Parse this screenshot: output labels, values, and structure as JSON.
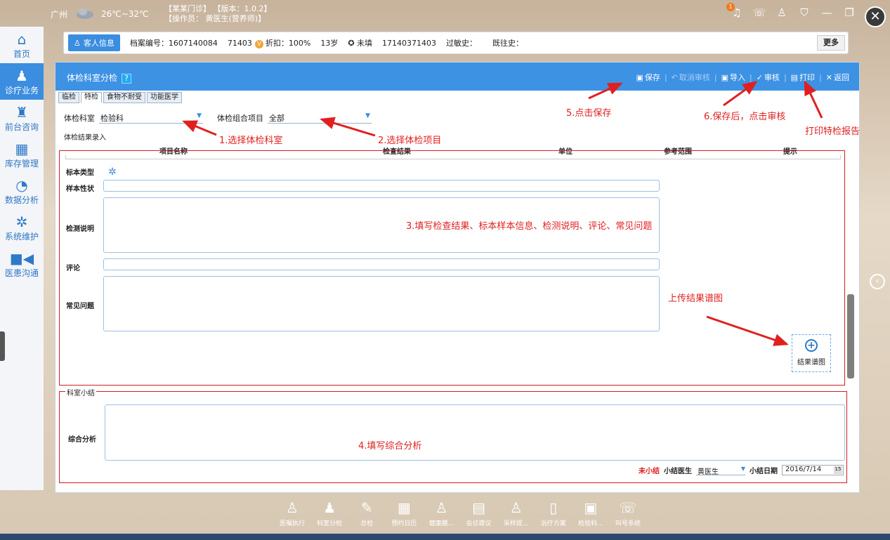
{
  "header": {
    "city": "广州",
    "temperature": "26℃~32℃",
    "clinic": "【某某门诊】",
    "version": "【版本：1.0.2】",
    "operator": "【操作员： 黄医生(营养师)】",
    "notification_count": "1"
  },
  "nav": [
    {
      "label": "首页",
      "icon": "home-icon"
    },
    {
      "label": "诊疗业务",
      "icon": "doctor-icon"
    },
    {
      "label": "前台咨询",
      "icon": "reception-icon"
    },
    {
      "label": "库存管理",
      "icon": "store-icon"
    },
    {
      "label": "数据分析",
      "icon": "chart-icon"
    },
    {
      "label": "系统维护",
      "icon": "gear-icon"
    },
    {
      "label": "医患沟通",
      "icon": "video-icon"
    }
  ],
  "patient": {
    "tab_label": "客人信息",
    "record_no": "档案编号：1607140084",
    "id": "71403",
    "discount": "折扣：100%",
    "age": "13岁",
    "marital": "未填",
    "phone": "17140371403",
    "allergy": "过敏史：",
    "history": "既往史：",
    "more": "更多"
  },
  "panel": {
    "title": "体检科室分检",
    "help": "?",
    "toolbar": {
      "save": "保存",
      "cancel_review": "取消审核",
      "import": "导入",
      "review": "审核",
      "print": "打印",
      "back": "返回"
    },
    "tabs": [
      "临检",
      "特检",
      "食物不耐受",
      "功能医学"
    ],
    "dept_label": "体检科室",
    "dept_value": "检验科",
    "combo_label": "体检组合项目",
    "combo_value": "全部",
    "entry_title": "体检结果录入",
    "columns": [
      "项目名称",
      "检查结果",
      "单位",
      "参考范围",
      "提示"
    ],
    "fields": {
      "sample_type": "标本类型",
      "sample_props": "样本性状",
      "test_desc": "检测说明",
      "comment": "评论",
      "faq": "常见问题"
    },
    "upload_label": "结果谱图",
    "summary_legend": "科室小结",
    "analysis_label": "综合分析",
    "unsummed": "未小结",
    "summary_doctor_label": "小结医生",
    "summary_doctor": "黄医生",
    "summary_date_label": "小结日期",
    "summary_date": "2016/7/14",
    "cal_icon": "15"
  },
  "annotations": {
    "a1": "1.选择体检科室",
    "a2": "2.选择体检项目",
    "a3": "3.填写检查结果、标本样本信息、检测说明、评论、常见问题",
    "a4": "4.填写综合分析",
    "a5": "5.点击保存",
    "a6": "6.保存后，点击审核",
    "a7": "打印特检报告",
    "a8": "上传结果谱图"
  },
  "dock": [
    "医嘱执行",
    "科室分检",
    "总检",
    "预约日历",
    "健康膳...",
    "会诊建议",
    "采样提...",
    "治疗方案",
    "检验科...",
    "叫号系统"
  ]
}
